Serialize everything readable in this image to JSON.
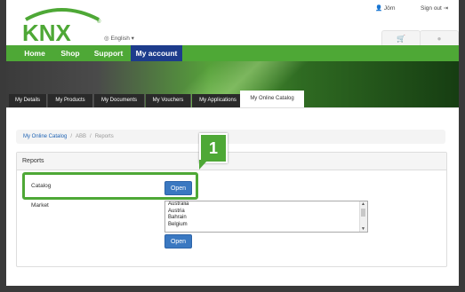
{
  "header": {
    "logo_text": "KNX",
    "language": "English",
    "user": "Jörn",
    "signout": "Sign out"
  },
  "main_nav": [
    "Home",
    "Shop",
    "Support",
    "My account"
  ],
  "sub_tabs": [
    "My Details",
    "My Products",
    "My Documents",
    "My Vouchers",
    "My Applications",
    "My Online Catalog"
  ],
  "breadcrumb": [
    "My Online Catalog",
    "/",
    "ABB",
    "/",
    "Reports"
  ],
  "panel": {
    "title": "Reports",
    "catalog_label": "Catalog",
    "open_label": "Open",
    "market_label": "Market",
    "market_options": [
      "Australia",
      "Austria",
      "Bahrain",
      "Belgium"
    ],
    "open2_label": "Open"
  },
  "callout_number": "1",
  "colors": {
    "knx_green": "#4ea836",
    "nav_blue": "#1d3c8c",
    "button_blue": "#3a78c1"
  }
}
